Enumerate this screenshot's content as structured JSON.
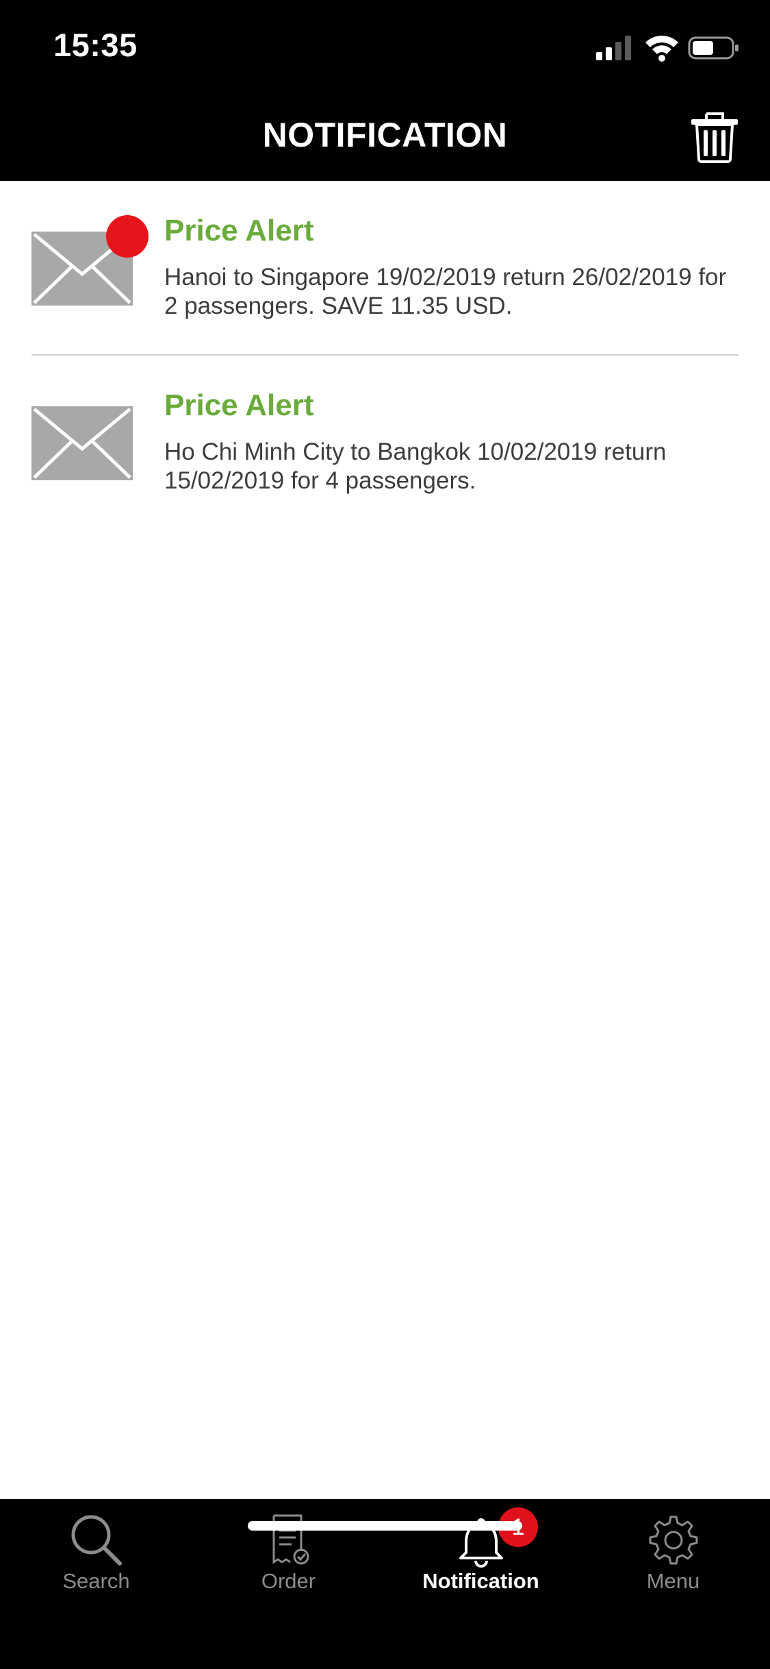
{
  "status_bar": {
    "time": "15:35"
  },
  "header": {
    "title": "NOTIFICATION"
  },
  "notifications": [
    {
      "title": "Price Alert",
      "body": "Hanoi to Singapore 19/02/2019 return 26/02/2019 for 2 passengers. SAVE 11.35 USD.",
      "unread": true
    },
    {
      "title": "Price Alert",
      "body": "Ho Chi Minh City to Bangkok 10/02/2019 return 15/02/2019 for 4 passengers.",
      "unread": false
    }
  ],
  "tabbar": {
    "tabs": [
      {
        "label": "Search",
        "icon": "search-icon"
      },
      {
        "label": "Order",
        "icon": "receipt-icon"
      },
      {
        "label": "Notification",
        "icon": "bell-icon",
        "active": true,
        "badge": "1"
      },
      {
        "label": "Menu",
        "icon": "gear-icon"
      }
    ]
  },
  "colors": {
    "accent_green": "#6aab3b",
    "badge_red": "#e0111c",
    "header_bg": "#000000"
  }
}
